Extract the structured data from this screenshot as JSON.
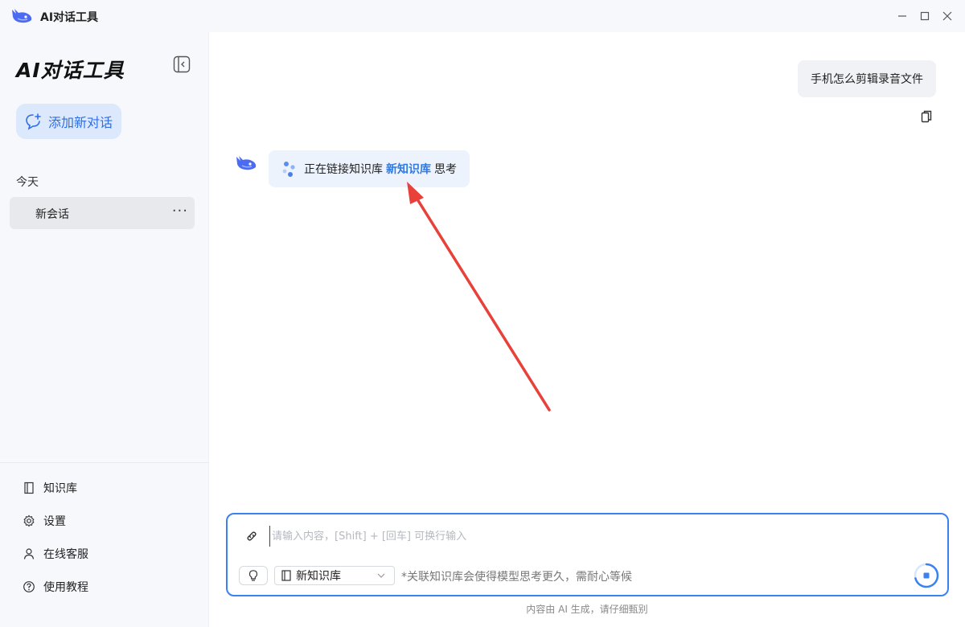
{
  "window": {
    "title": "AI对话工具"
  },
  "sidebar": {
    "title": "AI对话工具",
    "new_chat_label": "添加新对话",
    "group_label": "今天",
    "sessions": [
      {
        "label": "新会话",
        "more": "···"
      }
    ],
    "footer": [
      {
        "label": "知识库",
        "icon": "book-icon"
      },
      {
        "label": "设置",
        "icon": "gear-icon"
      },
      {
        "label": "在线客服",
        "icon": "user-icon"
      },
      {
        "label": "使用教程",
        "icon": "help-icon"
      }
    ]
  },
  "chat": {
    "user_message": "手机怎么剪辑录音文件",
    "bot_status_prefix": "正在链接知识库",
    "bot_status_kb": "新知识库",
    "bot_status_suffix": "思考"
  },
  "input": {
    "placeholder": "请输入内容，[Shift] + [回车] 可换行输入",
    "kb_selected": "新知识库",
    "hint": "*关联知识库会使得模型思考更久，需耐心等候"
  },
  "footer_note": "内容由 AI 生成，请仔细甄别",
  "colors": {
    "accent": "#3b82f0",
    "annotation_arrow": "#e8413a"
  }
}
